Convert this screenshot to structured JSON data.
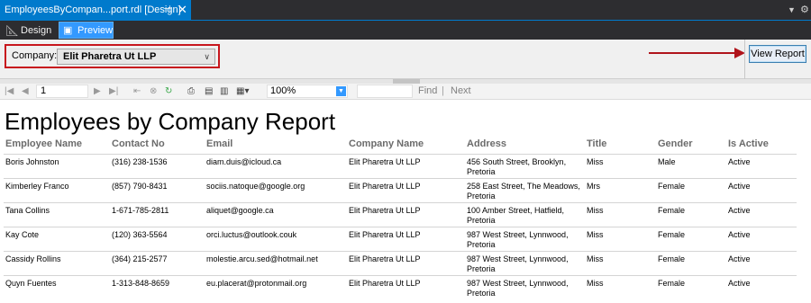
{
  "tab": {
    "title": "EmployeesByCompan...port.rdl [Design]",
    "pin": "⊣",
    "close": "✕"
  },
  "window_controls": {
    "menu": "▼",
    "settings": "⚙"
  },
  "modes": {
    "design": "Design",
    "preview": "Preview"
  },
  "parameters": {
    "label": "Company:",
    "value": "Elit Pharetra Ut LLP"
  },
  "view_report": "View Report",
  "toolbar": {
    "page": "1",
    "zoom": "100%",
    "find": "Find",
    "separator": "|",
    "next": "Next"
  },
  "report": {
    "title": "Employees by Company Report",
    "columns": [
      "Employee Name",
      "Contact No",
      "Email",
      "Company Name",
      "Address",
      "Title",
      "Gender",
      "Is Active"
    ],
    "rows": [
      [
        "Boris Johnston",
        "(316) 238-1536",
        "diam.duis@icloud.ca",
        "Elit Pharetra Ut LLP",
        "456 South Street, Brooklyn, Pretoria",
        "Miss",
        "Male",
        "Active"
      ],
      [
        "Kimberley Franco",
        "(857) 790-8431",
        "sociis.natoque@google.org",
        "Elit Pharetra Ut LLP",
        "258 East Street,  The Meadows, Pretoria",
        "Mrs",
        "Female",
        "Active"
      ],
      [
        "Tana Collins",
        "1-671-785-2811",
        "aliquet@google.ca",
        "Elit Pharetra Ut LLP",
        "100 Amber Street, Hatfield, Pretoria",
        "Miss",
        "Female",
        "Active"
      ],
      [
        "Kay Cote",
        "(120) 363-5564",
        "orci.luctus@outlook.couk",
        "Elit Pharetra Ut LLP",
        "987 West Street,  Lynnwood, Pretoria",
        "Miss",
        "Female",
        "Active"
      ],
      [
        "Cassidy Rollins",
        "(364) 215-2577",
        "molestie.arcu.sed@hotmail.net",
        "Elit Pharetra Ut LLP",
        "987 West Street,  Lynnwood, Pretoria",
        "Miss",
        "Female",
        "Active"
      ],
      [
        "Quyn Fuentes",
        "1-313-848-8659",
        "eu.placerat@protonmail.org",
        "Elit Pharetra Ut LLP",
        "987 West Street,  Lynnwood, Pretoria",
        "Miss",
        "Female",
        "Active"
      ]
    ]
  },
  "colors": {
    "tab_accent": "#007acc",
    "preview_active": "#3399ff",
    "highlight_border": "#c7161d",
    "arrow": "#b0141b"
  }
}
